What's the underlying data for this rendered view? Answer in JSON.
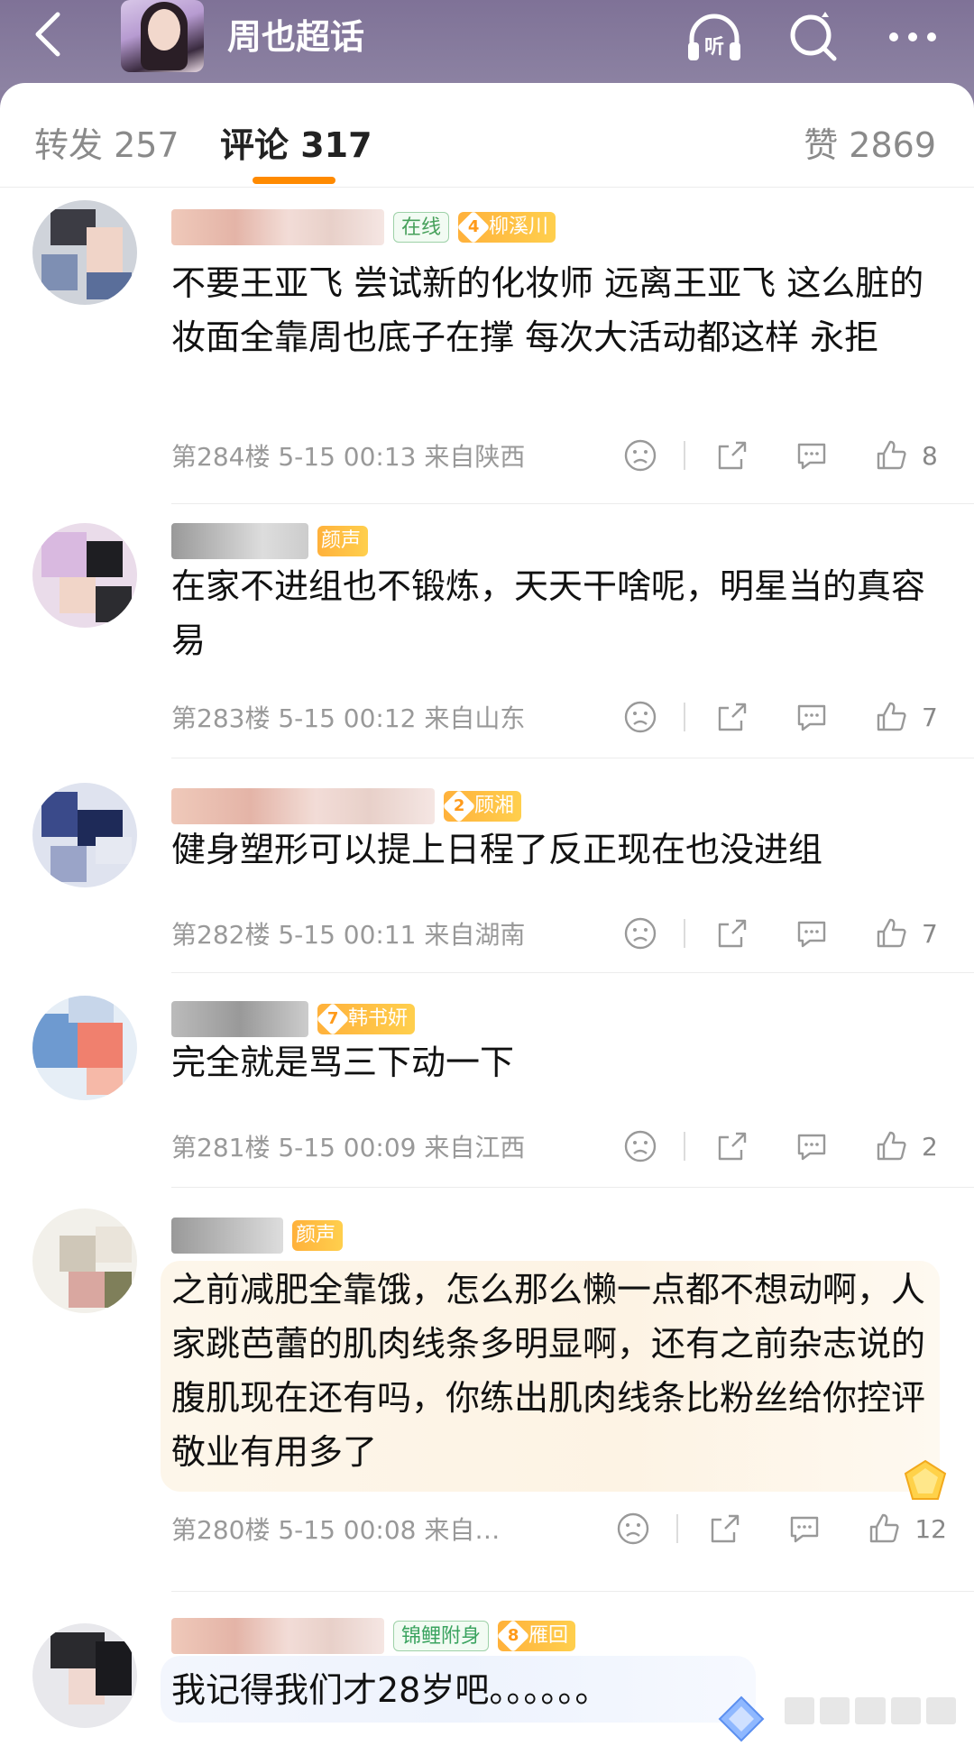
{
  "header": {
    "title": "周也超话",
    "back_icon": "chevron-left-icon",
    "listen_icon": "headphones-icon",
    "listen_label": "听",
    "search_icon": "search-icon",
    "more_icon": "more-icon"
  },
  "tabs": {
    "repost": "转发 257",
    "comments": "评论 317",
    "likes": "赞 2869"
  },
  "comments": [
    {
      "badges": [
        "在线",
        "柳溪川"
      ],
      "fan_level": "4",
      "text": "不要王亚飞 尝试新的化妆师 远离王亚飞 这么脏的妆面全靠周也底子在撑 每次大活动都这样 永拒",
      "meta": "第284楼 5-15 00:13 来自陕西",
      "likes": "8"
    },
    {
      "badges": [
        "颜声"
      ],
      "fan_level": "",
      "text": "在家不进组也不锻炼，天天干啥呢，明星当的真容易",
      "meta": "第283楼 5-15 00:12 来自山东",
      "likes": "7"
    },
    {
      "badges": [
        "顾湘"
      ],
      "fan_level": "2",
      "text": "健身塑形可以提上日程了反正现在也没进组",
      "meta": "第282楼 5-15 00:11 来自湖南",
      "likes": "7"
    },
    {
      "badges": [
        "韩书妍"
      ],
      "fan_level": "7",
      "text": "完全就是骂三下动一下",
      "meta": "第281楼 5-15 00:09 来自江西",
      "likes": "2"
    },
    {
      "badges": [
        "颜声"
      ],
      "fan_level": "",
      "text": "之前减肥全靠饿，怎么那么懒一点都不想动啊，人家跳芭蕾的肌肉线条多明显啊，还有之前杂志说的腹肌现在还有吗，你练出肌肉线条比粉丝给你控评敬业有用多了",
      "meta": "第280楼 5-15 00:08 来自…",
      "likes": "12"
    },
    {
      "badges": [
        "锦鲤附身",
        "雁回"
      ],
      "fan_level": "8",
      "text": "我记得我们才28岁吧。。。。。。",
      "meta": "",
      "likes": ""
    }
  ],
  "colors": {
    "header_bg": "#8a7fa0",
    "accent": "#ff8a00",
    "badge_fan": "#ffb13b",
    "badge_green": "#46a05a"
  }
}
